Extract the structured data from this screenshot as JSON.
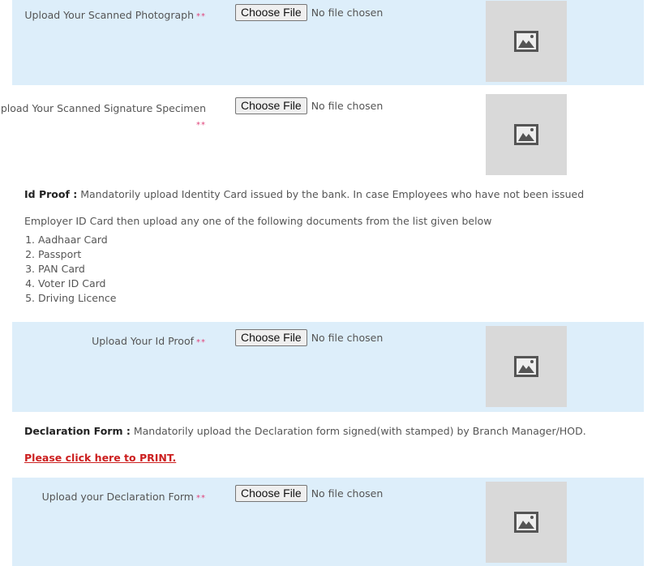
{
  "required_marker": "**",
  "file_input": {
    "button_label": "Choose File",
    "status": "No file chosen"
  },
  "uploads": {
    "photo": {
      "label": "Upload Your Scanned Photograph"
    },
    "signature": {
      "label": "Upload Your Scanned Signature Specimen"
    },
    "id_proof": {
      "label": "Upload Your Id Proof"
    },
    "declaration": {
      "label": "Upload your Declaration Form"
    }
  },
  "id_proof_info": {
    "heading": "Id Proof :",
    "line1": "Mandatorily upload Identity Card issued by the bank. In case Employees who have not been issued",
    "line2": "Employer ID Card then upload any one of the following documents from the list given below",
    "documents": [
      "Aadhaar Card",
      "Passport",
      "PAN Card",
      "Voter ID Card",
      "Driving Licence"
    ]
  },
  "declaration_info": {
    "heading": "Declaration Form :",
    "text": "Mandatorily upload the Declaration form signed(with stamped) by Branch Manager/HOD.",
    "print_link": "Please click here to PRINT."
  },
  "icons": {
    "preview": "image-placeholder-icon"
  },
  "colors": {
    "row_bg": "#ddeefa",
    "required": "#e0457b",
    "link": "#cc1f1f",
    "preview_bg": "#d9d9d9"
  }
}
